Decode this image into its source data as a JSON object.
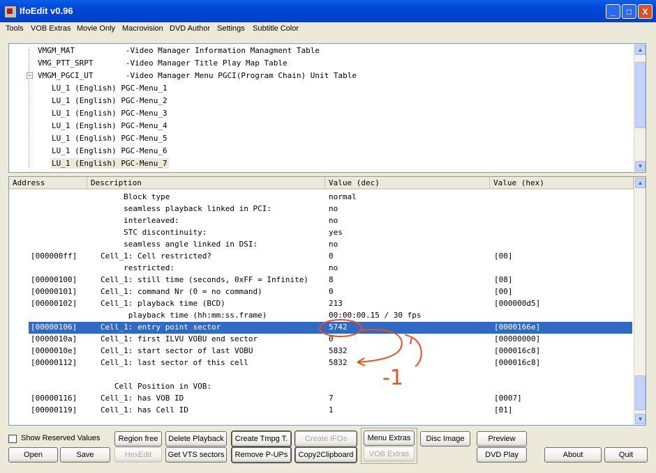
{
  "window": {
    "title": "IfoEdit v0.96",
    "controls": [
      "_",
      "□",
      "X"
    ]
  },
  "menu": [
    "Tools",
    "VOB Extras",
    "Movie Only",
    "Macrovision",
    "DVD Author",
    "Settings",
    "Subtitle Color"
  ],
  "tree": {
    "rows": [
      {
        "text": "VMGM_MAT           -Video Manager Information Managment Table"
      },
      {
        "text": "VMG_PTT_SRPT       -Video Manager Title Play Map Table"
      },
      {
        "text": "VMGM_PGCI_UT       -Video Manager Menu PGCI(Program Chain) Unit Table",
        "expander": "−"
      },
      {
        "text": "LU_1 (English) PGC-Menu_1"
      },
      {
        "text": "LU_1 (English) PGC-Menu_2"
      },
      {
        "text": "LU_1 (English) PGC-Menu_3"
      },
      {
        "text": "LU_1 (English) PGC-Menu_4"
      },
      {
        "text": "LU_1 (English) PGC-Menu_5"
      },
      {
        "text": "LU_1 (English) PGC-Menu_6"
      },
      {
        "text": "LU_1 (English) PGC-Menu_7",
        "selected": true
      }
    ]
  },
  "table": {
    "columns": [
      "Address",
      "Description",
      "Value (dec)",
      "Value (hex)"
    ],
    "rows": [
      {
        "addr": "",
        "desc": "     Block type",
        "dec": "normal",
        "hex": ""
      },
      {
        "addr": "",
        "desc": "     seamless playback linked in PCI:",
        "dec": "no",
        "hex": ""
      },
      {
        "addr": "",
        "desc": "     interleaved:",
        "dec": "no",
        "hex": ""
      },
      {
        "addr": "",
        "desc": "     STC discontinuity:",
        "dec": "yes",
        "hex": ""
      },
      {
        "addr": "",
        "desc": "     seamless angle linked in DSI:",
        "dec": "no",
        "hex": ""
      },
      {
        "addr": "[000000ff]",
        "desc": "Cell_1: Cell restricted?",
        "dec": "0",
        "hex": "[00]"
      },
      {
        "addr": "",
        "desc": "     restricted:",
        "dec": "no",
        "hex": ""
      },
      {
        "addr": "[00000100]",
        "desc": "Cell_1: still time (seconds, 0xFF = Infinite)",
        "dec": "8",
        "hex": "[08]"
      },
      {
        "addr": "[00000101]",
        "desc": "Cell_1: command Nr (0 = no command)",
        "dec": "0",
        "hex": "[00]"
      },
      {
        "addr": "[00000102]",
        "desc": "Cell_1: playback time (BCD)",
        "dec": "213",
        "hex": "[000000d5]"
      },
      {
        "addr": "",
        "desc": "      playback time (hh:mm:ss.frame)",
        "dec": "00:00:00.15 / 30 fps",
        "hex": ""
      },
      {
        "addr": "[00000106]",
        "desc": "Cell_1: entry point sector",
        "dec": "5742",
        "hex": "[0000166e]",
        "selected": true
      },
      {
        "addr": "[0000010a]",
        "desc": "Cell_1: first ILVU VOBU end sector",
        "dec": "0",
        "hex": "[00000000]"
      },
      {
        "addr": "[0000010e]",
        "desc": "Cell_1: start sector of last VOBU",
        "dec": "5832",
        "hex": "[000016c8]"
      },
      {
        "addr": "[00000112]",
        "desc": "Cell_1: last sector of this cell",
        "dec": "5832",
        "hex": "[000016c8]"
      },
      {
        "addr": "",
        "desc": "",
        "dec": "",
        "hex": ""
      },
      {
        "addr": "",
        "desc": "   Cell Position in VOB:",
        "dec": "",
        "hex": ""
      },
      {
        "addr": "[00000116]",
        "desc": "Cell_1: has VOB ID",
        "dec": "7",
        "hex": "[0007]"
      },
      {
        "addr": "[00000119]",
        "desc": "Cell_1: has Cell ID",
        "dec": "1",
        "hex": "[01]"
      }
    ]
  },
  "annotation": {
    "text": "-1",
    "color": "#e8501e"
  },
  "buttons": {
    "show_reserved": "Show Reserved Values",
    "open": "Open",
    "save": "Save",
    "region_free": "Region free",
    "hexedit": "HexEdit",
    "delete_playback": "Delete Playback",
    "get_vts_sectors": "Get VTS sectors",
    "create_tmpg": "Create Tmpg T.",
    "remove_pups": "Remove P-UPs",
    "create_ifos": "Create IFOs",
    "copy2clipboard": "Copy2Clipboard",
    "menu_extras": "Menu Extras",
    "vob_extras": "VOB Extras",
    "disc_image": "Disc Image",
    "preview": "Preview",
    "dvd_play": "DVD Play",
    "about": "About",
    "quit": "Quit"
  }
}
